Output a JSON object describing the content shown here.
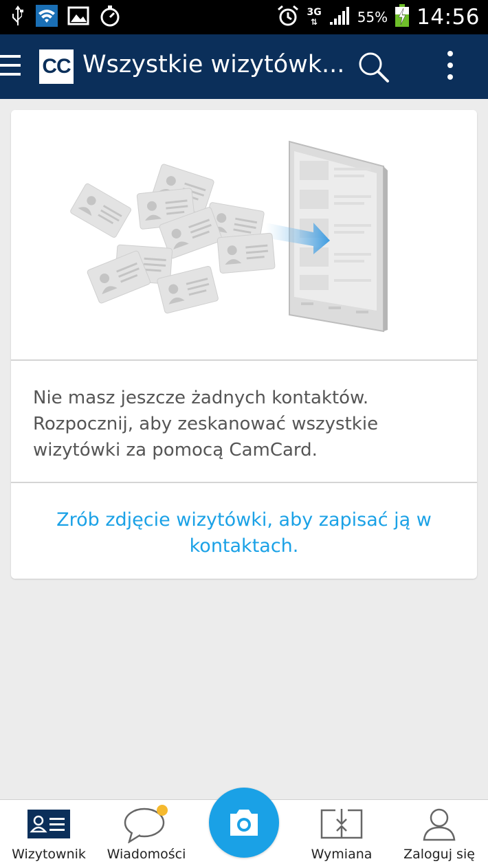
{
  "status_bar": {
    "battery_percent": "55%",
    "network": "3G",
    "time": "14:56"
  },
  "app_bar": {
    "logo_text": "CC",
    "title": "Wszystkie wizytówk..."
  },
  "empty_state": {
    "message": "Nie masz jeszcze żadnych kontaktów. Rozpocznij, aby zeskanować wszystkie wizytówki za pomocą CamCard.",
    "cta": "Zrób zdjęcie wizytówki, aby zapisać ją w kontaktach."
  },
  "bottom_nav": {
    "items": [
      {
        "label": "Wizytownik",
        "icon": "business-card-icon"
      },
      {
        "label": "Wiadomości",
        "icon": "chat-bubble-icon"
      },
      {
        "label": "",
        "icon": "camera-icon"
      },
      {
        "label": "Wymiana",
        "icon": "exchange-icon"
      },
      {
        "label": "Zaloguj się",
        "icon": "user-icon"
      }
    ]
  },
  "colors": {
    "app_bar": "#0b2f5a",
    "accent": "#1aa1e6",
    "notification_dot": "#f5b92e",
    "background": "#ececec"
  }
}
